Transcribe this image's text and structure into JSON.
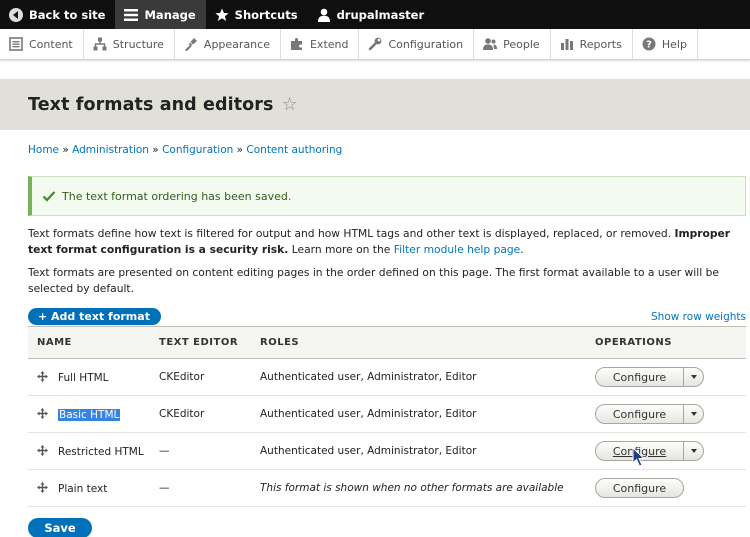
{
  "toolbar": {
    "back": "Back to site",
    "manage": "Manage",
    "shortcuts": "Shortcuts",
    "user": "drupalmaster"
  },
  "tray": [
    {
      "label": "Content",
      "icon": "content-icon"
    },
    {
      "label": "Structure",
      "icon": "structure-icon"
    },
    {
      "label": "Appearance",
      "icon": "appearance-icon"
    },
    {
      "label": "Extend",
      "icon": "extend-icon"
    },
    {
      "label": "Configuration",
      "icon": "configuration-icon"
    },
    {
      "label": "People",
      "icon": "people-icon"
    },
    {
      "label": "Reports",
      "icon": "reports-icon"
    },
    {
      "label": "Help",
      "icon": "help-icon"
    }
  ],
  "page": {
    "title": "Text formats and editors"
  },
  "breadcrumb": {
    "home": "Home",
    "administration": "Administration",
    "configuration": "Configuration",
    "content_authoring": "Content authoring",
    "sep": " » "
  },
  "message": "The text format ordering has been saved.",
  "description": {
    "p1_start": "Text formats define how text is filtered for output and how HTML tags and other text is displayed, replaced, or removed. ",
    "p1_bold": "Improper text format configuration is a security risk.",
    "p1_mid": " Learn more on the ",
    "p1_link": "Filter module help page",
    "p1_end": ".",
    "p2": "Text formats are presented on content editing pages in the order defined on this page. The first format available to a user will be selected by default."
  },
  "add_button": "+ Add text format",
  "row_weights": "Show row weights",
  "table": {
    "headers": {
      "name": "NAME",
      "editor": "TEXT EDITOR",
      "roles": "ROLES",
      "operations": "OPERATIONS"
    },
    "rows": [
      {
        "name": "Full HTML",
        "editor": "CKEditor",
        "roles": "Authenticated user, Administrator, Editor",
        "operation": "Configure"
      },
      {
        "name": "Basic HTML",
        "editor": "CKEditor",
        "roles": "Authenticated user, Administrator, Editor",
        "operation": "Configure"
      },
      {
        "name": "Restricted HTML",
        "editor": "—",
        "roles": "Authenticated user, Administrator, Editor",
        "operation": "Configure"
      },
      {
        "name": "Plain text",
        "editor": "—",
        "roles": "This format is shown when no other formats are available",
        "operation": "Configure"
      }
    ]
  },
  "save_button": "Save",
  "colors": {
    "toolbar_bg": "#0f0f0f",
    "link": "#0074bd",
    "primary_button": "#0071b8",
    "status_border": "#77b259",
    "page_header_bg": "#e0e0d8",
    "selection": "#3584e4"
  }
}
